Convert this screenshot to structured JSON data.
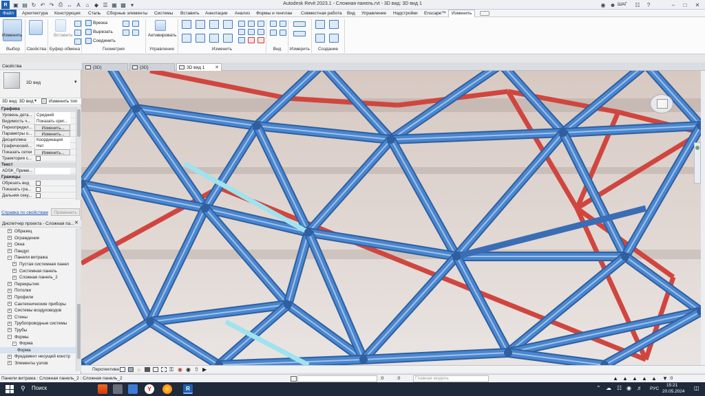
{
  "title": "Autodesk Revit 2023.1 - Сложная панель.rvt - 3D вид: 3D вид 1",
  "user": "ШАГ",
  "ribbon_tabs": [
    "Файл",
    "Архитектура",
    "Конструкция",
    "Сталь",
    "Сборные элементы",
    "Системы",
    "Вставить",
    "Аннотации",
    "Анализ",
    "Формы и генплан",
    "Совместная работа",
    "Вид",
    "Управление",
    "Надстройки",
    "Enscape™",
    "Изменить"
  ],
  "ribbon": {
    "select_btn": "Изменить",
    "properties_btn": "Свойства",
    "paste_btn": "Вставить",
    "cut": "Врезка",
    "cutout": "Вырезать",
    "join": "Соединить",
    "activate": "Активировать",
    "panels": [
      "Выбор",
      "Свойства",
      "Буфер обмена",
      "Геометрия",
      "Управление",
      "Изменить",
      "Вид",
      "Измерить",
      "Создание"
    ]
  },
  "properties": {
    "header": "Свойства",
    "type_name": "3D вид",
    "view_selector": "3D вид: 3D вид",
    "edit_type": "Изменить тип",
    "groups": [
      "Графика",
      "Текст",
      "Границы"
    ],
    "rows": [
      {
        "k": "Уровень дета...",
        "v": "Средний"
      },
      {
        "k": "Видимость ч...",
        "v": "Показать ориг..."
      },
      {
        "k": "Переопредел...",
        "v": "Изменить..."
      },
      {
        "k": "Параметры о...",
        "v": "Изменить..."
      },
      {
        "k": "Дисциплина",
        "v": "Координация"
      },
      {
        "k": "Графический...",
        "v": "Нет"
      },
      {
        "k": "Показать сетки",
        "v": "Изменить..."
      },
      {
        "k": "Траектория с...",
        "v": ""
      }
    ],
    "text_row": "ADSK_Приме...",
    "bound_rows": [
      "Обрезать вид",
      "Показать гра...",
      "Дальняя секу..."
    ],
    "help_link": "Справка по свойствам",
    "apply": "Применить"
  },
  "browser": {
    "header": "Диспетчер проекта - Сложная па...",
    "items": [
      {
        "label": "Образец",
        "level": 1,
        "pm": "+"
      },
      {
        "label": "Ограждение",
        "level": 1,
        "pm": "+"
      },
      {
        "label": "Окна",
        "level": 1,
        "pm": "+"
      },
      {
        "label": "Пандус",
        "level": 1,
        "pm": "+"
      },
      {
        "label": "Панели витража",
        "level": 1,
        "pm": "−"
      },
      {
        "label": "Пустая системная панел",
        "level": 2,
        "pm": "+"
      },
      {
        "label": "Системная панель",
        "level": 2,
        "pm": "+"
      },
      {
        "label": "Сложная панель_2",
        "level": 2,
        "pm": "+"
      },
      {
        "label": "Перекрытия",
        "level": 1,
        "pm": "+"
      },
      {
        "label": "Потолки",
        "level": 1,
        "pm": "+"
      },
      {
        "label": "Профили",
        "level": 1,
        "pm": "+"
      },
      {
        "label": "Сантехнические приборы",
        "level": 1,
        "pm": "+"
      },
      {
        "label": "Системы воздуховодов",
        "level": 1,
        "pm": "+"
      },
      {
        "label": "Стены",
        "level": 1,
        "pm": "+"
      },
      {
        "label": "Трубопроводные системы",
        "level": 1,
        "pm": "+"
      },
      {
        "label": "Трубы",
        "level": 1,
        "pm": "+"
      },
      {
        "label": "Формы",
        "level": 1,
        "pm": "−"
      },
      {
        "label": "Форма",
        "level": 2,
        "pm": "−"
      },
      {
        "label": "Форма",
        "level": 3,
        "pm": ""
      },
      {
        "label": "Фундамент несущей констр",
        "level": 1,
        "pm": "+"
      },
      {
        "label": "Элементы узлов",
        "level": 1,
        "pm": "+"
      }
    ]
  },
  "view_tabs": [
    "{3D}",
    "{3D}",
    "3D вид 1"
  ],
  "viewbar": {
    "mode": "Перспектива"
  },
  "status": {
    "text": "Панели витража : Сложная панель_2 : Сложная панель_2",
    "zero1": ":0",
    "zero2": ":0",
    "model": "Главная модель",
    "filter": ":0"
  },
  "taskbar": {
    "search": "Поиск",
    "lang": "РУС",
    "time": "15:21",
    "date": "20.05.2024"
  },
  "colors": {
    "accent": "#1e5fb4",
    "frame_blue": "#4a86cf",
    "frame_red": "#d0463f"
  }
}
